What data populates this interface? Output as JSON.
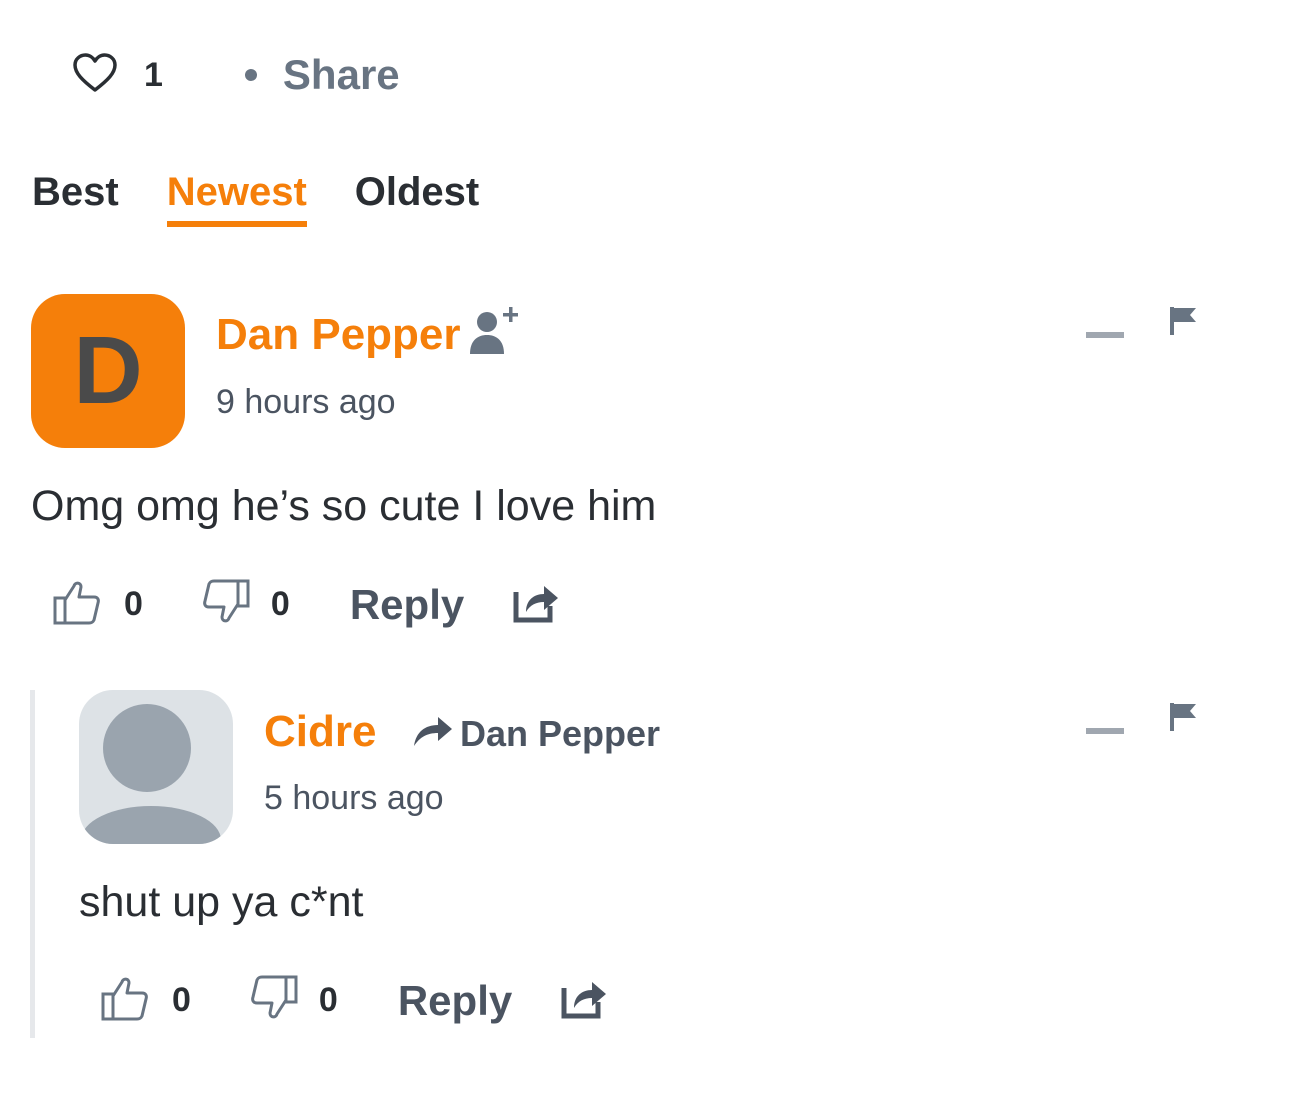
{
  "post_bar": {
    "like_count": "1",
    "share_label": "Share"
  },
  "sort_tabs": [
    {
      "label": "Best"
    },
    {
      "label": "Newest"
    },
    {
      "label": "Oldest"
    }
  ],
  "comments": [
    {
      "avatar_letter": "D",
      "author": "Dan Pepper",
      "time": "9 hours ago",
      "text": "Omg omg he’s so cute I love him",
      "upvotes": "0",
      "downvotes": "0",
      "reply_label": "Reply"
    },
    {
      "author": "Cidre",
      "reply_to": "Dan Pepper",
      "time": "5 hours ago",
      "text": "shut up ya c*nt",
      "upvotes": "0",
      "downvotes": "0",
      "reply_label": "Reply"
    }
  ],
  "colors": {
    "accent": "#f57f0a",
    "text": "#2a2e33",
    "muted": "#687482"
  }
}
